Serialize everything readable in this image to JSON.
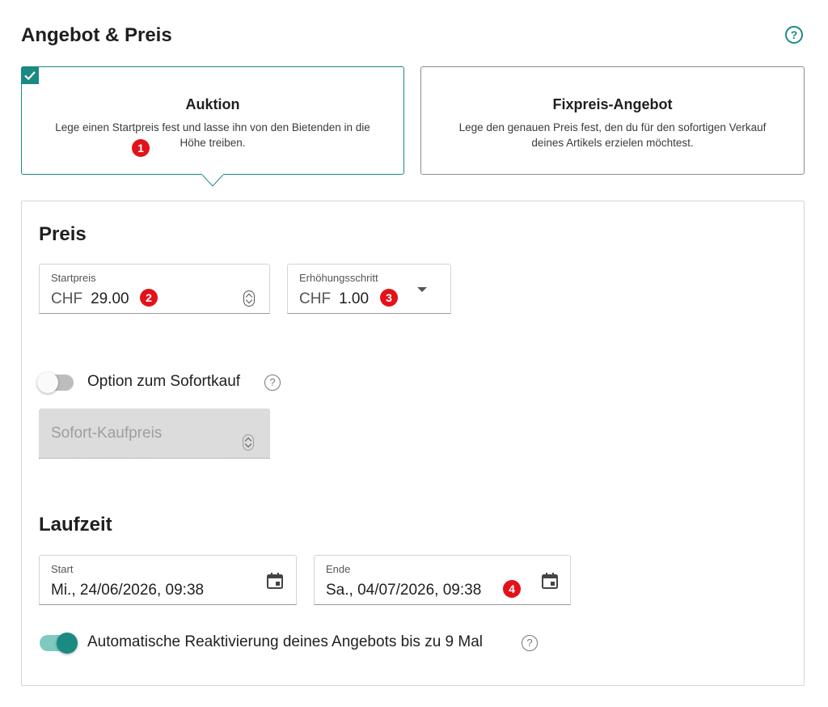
{
  "header": {
    "title": "Angebot & Preis",
    "help_icon": "question-circle-icon",
    "help_glyph": "?"
  },
  "offer_types": [
    {
      "title": "Auktion",
      "description": "Lege einen Startpreis fest und lasse ihn von den Bietenden in die Höhe treiben.",
      "selected": true,
      "badge": "1"
    },
    {
      "title": "Fixpreis-Angebot",
      "description": "Lege den genauen Preis fest, den du für den sofortigen Verkauf deines Artikels erzielen möchtest.",
      "selected": false
    }
  ],
  "price": {
    "section_title": "Preis",
    "start_price": {
      "label": "Startpreis",
      "currency": "CHF",
      "value": "29.00",
      "badge": "2"
    },
    "increment": {
      "label": "Erhöhungsschritt",
      "currency": "CHF",
      "value": "1.00",
      "badge": "3"
    },
    "buy_now": {
      "label": "Option zum Sofortkauf",
      "enabled": false,
      "placeholder": "Sofort-Kaufpreis",
      "help_glyph": "?"
    }
  },
  "duration": {
    "section_title": "Laufzeit",
    "start": {
      "label": "Start",
      "value": "Mi., 24/06/2026, 09:38"
    },
    "end": {
      "label": "Ende",
      "value": "Sa., 04/07/2026, 09:38",
      "badge": "4"
    },
    "auto_reactivation": {
      "label": "Automatische Reaktivierung deines Angebots bis zu 9 Mal",
      "enabled": true,
      "help_glyph": "?"
    }
  },
  "colors": {
    "accent": "#1a8a83",
    "badge": "#e3121a",
    "toggle_on_track": "#7fc9c1",
    "toggle_off_track": "#bdbdbd",
    "disabled_field": "#dcdcdc"
  }
}
